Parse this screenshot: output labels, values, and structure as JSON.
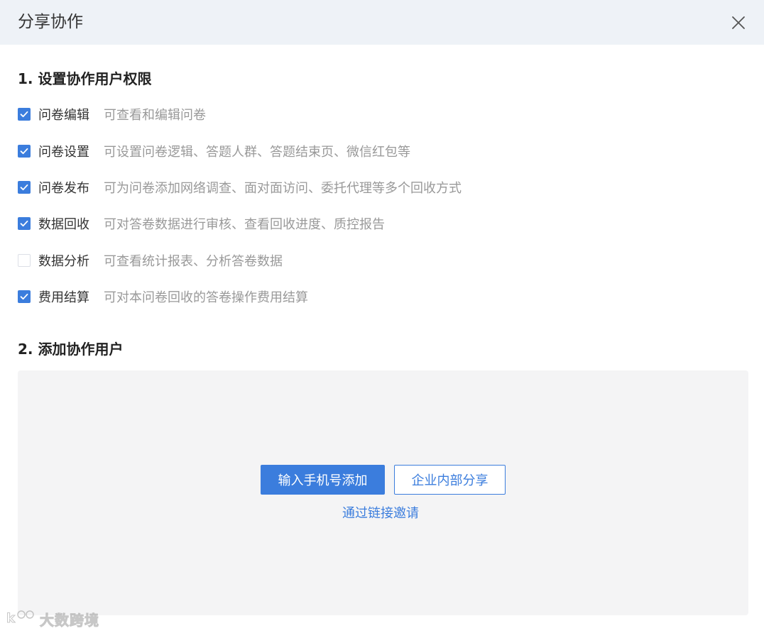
{
  "dialog": {
    "title": "分享协作",
    "close_icon": "close-icon"
  },
  "section1": {
    "title": "1. 设置协作用户权限",
    "permissions": [
      {
        "label": "问卷编辑",
        "desc": "可查看和编辑问卷",
        "checked": true
      },
      {
        "label": "问卷设置",
        "desc": "可设置问卷逻辑、答题人群、答题结束页、微信红包等",
        "checked": true
      },
      {
        "label": "问卷发布",
        "desc": "可为问卷添加网络调查、面对面访问、委托代理等多个回收方式",
        "checked": true
      },
      {
        "label": "数据回收",
        "desc": "可对答卷数据进行审核、查看回收进度、质控报告",
        "checked": true
      },
      {
        "label": "数据分析",
        "desc": "可查看统计报表、分析答卷数据",
        "checked": false
      },
      {
        "label": "费用结算",
        "desc": "可对本问卷回收的答卷操作费用结算",
        "checked": true
      }
    ]
  },
  "section2": {
    "title": "2. 添加协作用户",
    "phone_button": "输入手机号添加",
    "enterprise_button": "企业内部分享",
    "link_invite": "通过链接邀请"
  },
  "watermark": {
    "text": "大数跨境"
  },
  "colors": {
    "accent": "#3b7ddd",
    "header_bg": "#eef2f7",
    "panel_bg": "#f4f4f5",
    "desc_text": "#999999"
  }
}
